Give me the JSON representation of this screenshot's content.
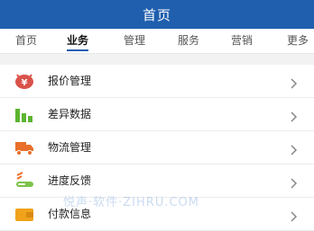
{
  "header": {
    "title": "首页"
  },
  "tabs": [
    {
      "label": "首页",
      "active": false
    },
    {
      "label": "业务",
      "active": true
    },
    {
      "label": "管理",
      "active": false
    },
    {
      "label": "服务",
      "active": false
    },
    {
      "label": "营销",
      "active": false
    },
    {
      "label": "更多",
      "active": false
    }
  ],
  "menu": [
    {
      "label": "报价管理",
      "icon": "yen-price-icon"
    },
    {
      "label": "差异数据",
      "icon": "bar-chart-icon"
    },
    {
      "label": "物流管理",
      "icon": "truck-icon"
    },
    {
      "label": "进度反馈",
      "icon": "progress-icon"
    },
    {
      "label": "付款信息",
      "icon": "wallet-icon"
    }
  ],
  "watermark": "悦声·软件·ZIHRU.COM",
  "colors": {
    "header_bg": "#1f5fae",
    "active_tab_underline": "#1f5fae",
    "page_bg": "#f2f2f2"
  }
}
